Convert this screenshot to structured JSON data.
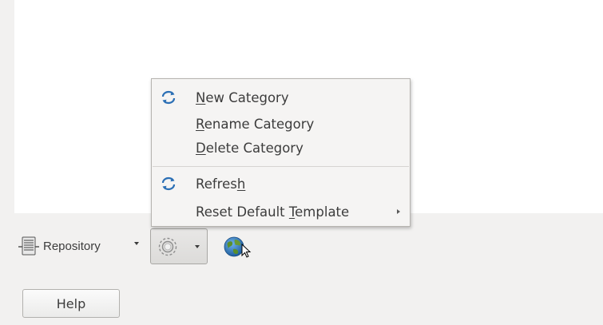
{
  "toolbar": {
    "repository_label": "Repository",
    "repository_icon": "server-rack-icon",
    "settings_icon": "gear-icon",
    "globe_icon": "globe-icon",
    "cursor_icon": "mouse-pointer-icon"
  },
  "menu": {
    "items": [
      {
        "label": "New Category",
        "mnemonic_index": 0,
        "icon": "refresh-arrows-icon"
      },
      {
        "label": "Rename Category",
        "mnemonic_index": 0,
        "icon": ""
      },
      {
        "label": "Delete Category",
        "mnemonic_index": 0,
        "icon": ""
      },
      {
        "label": "Refresh",
        "mnemonic_index": 6,
        "icon": "refresh-arrows-icon"
      },
      {
        "label": "Reset Default Template",
        "mnemonic_index": 14,
        "icon": "",
        "has_submenu": true
      }
    ]
  },
  "footer": {
    "help_label": "Help"
  },
  "colors": {
    "window_bg": "#f2f1f0",
    "panel_bg": "#ffffff",
    "menu_bg": "#f5f4f3",
    "text": "#3c3c3c",
    "icon_blue": "#2b6fb5"
  }
}
